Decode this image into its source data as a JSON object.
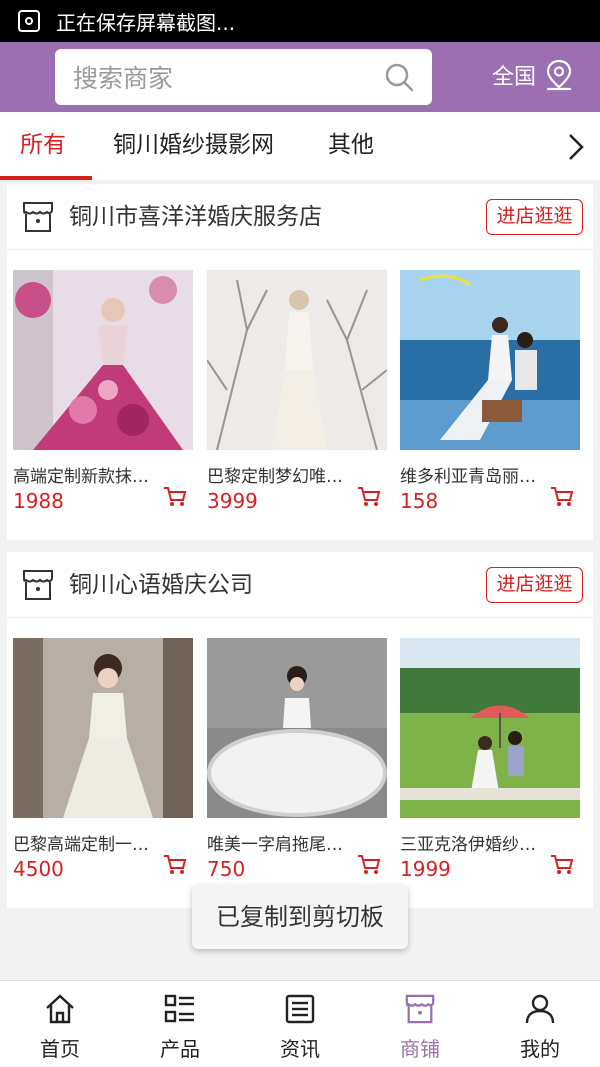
{
  "status_bar": {
    "notification": "正在保存屏幕截图..."
  },
  "header": {
    "search_placeholder": "搜索商家",
    "region_label": "全国",
    "bg_color": "#9b6fb2"
  },
  "tabs": [
    {
      "label": "所有",
      "active": true
    },
    {
      "label": "铜川婚纱摄影网",
      "active": false
    },
    {
      "label": "其他",
      "active": false
    }
  ],
  "shops": [
    {
      "name": "铜川市喜洋洋婚庆服务店",
      "enter_label": "进店逛逛",
      "products": [
        {
          "name": "高端定制新款抹…",
          "price": "1988"
        },
        {
          "name": "巴黎定制梦幻唯…",
          "price": "3999"
        },
        {
          "name": "维多利亚青岛丽…",
          "price": "158"
        }
      ]
    },
    {
      "name": "铜川心语婚庆公司",
      "enter_label": "进店逛逛",
      "products": [
        {
          "name": "巴黎高端定制一…",
          "price": "4500"
        },
        {
          "name": "唯美一字肩拖尾…",
          "price": "750"
        },
        {
          "name": "三亚克洛伊婚纱…",
          "price": "1999"
        }
      ]
    }
  ],
  "toast": "已复制到剪切板",
  "bottom_nav": [
    {
      "label": "首页",
      "icon": "home-icon",
      "active": false
    },
    {
      "label": "产品",
      "icon": "grid-list-icon",
      "active": false
    },
    {
      "label": "资讯",
      "icon": "news-icon",
      "active": false
    },
    {
      "label": "商铺",
      "icon": "store-icon",
      "active": true
    },
    {
      "label": "我的",
      "icon": "user-icon",
      "active": false
    }
  ],
  "colors": {
    "accent": "#d72020",
    "brand": "#9b6fb2"
  }
}
